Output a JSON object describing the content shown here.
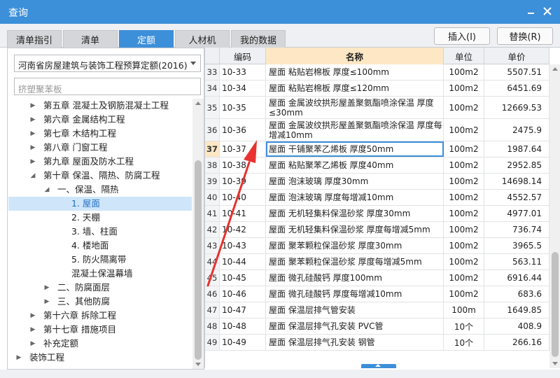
{
  "window": {
    "title": "查询"
  },
  "tabs": [
    {
      "label": "清单指引"
    },
    {
      "label": "清单"
    },
    {
      "label": "定额",
      "active": true
    },
    {
      "label": "人材机"
    },
    {
      "label": "我的数据"
    }
  ],
  "actions": {
    "insert_label": "插入(I)",
    "replace_label": "替换(R)"
  },
  "left_panel": {
    "library_selected": "河南省房屋建筑与装饰工程预算定额(2016)",
    "search_placeholder": "挤塑聚苯板",
    "tree": [
      {
        "label": "第五章 混凝土及钢筋混凝土工程",
        "toggle": "▶"
      },
      {
        "label": "第六章 金属结构工程",
        "toggle": "▶"
      },
      {
        "label": "第七章 木结构工程",
        "toggle": "▶"
      },
      {
        "label": "第八章 门窗工程",
        "toggle": "▶"
      },
      {
        "label": "第九章 屋面及防水工程",
        "toggle": "▶"
      },
      {
        "label": "第十章 保温、隔热、防腐工程",
        "toggle": "◢"
      },
      {
        "label": "一、保温、隔热",
        "toggle": "◢"
      },
      {
        "label": "1. 屋面",
        "toggle": "",
        "selected": true
      },
      {
        "label": "2. 天棚",
        "toggle": ""
      },
      {
        "label": "3. 墙、柱面",
        "toggle": ""
      },
      {
        "label": "4. 楼地面",
        "toggle": ""
      },
      {
        "label": "5. 防火隔离带",
        "toggle": ""
      },
      {
        "label": "混凝土保温幕墙",
        "toggle": ""
      },
      {
        "label": "二、防腐面层",
        "toggle": "▶"
      },
      {
        "label": "三、其他防腐",
        "toggle": "▶"
      },
      {
        "label": "第十六章 拆除工程",
        "toggle": "▶"
      },
      {
        "label": "第十七章 措施项目",
        "toggle": "▶"
      },
      {
        "label": "补充定额",
        "toggle": "▶"
      },
      {
        "label": "装饰工程",
        "toggle": "▶"
      }
    ]
  },
  "table": {
    "headers": {
      "code": "编码",
      "name": "名称",
      "unit": "单位",
      "price": "单价"
    },
    "current_row_index": 4,
    "rows": [
      {
        "idx": "33",
        "code": "10-33",
        "name": "屋面 粘贴岩棉板 厚度≤100mm",
        "unit": "100m2",
        "price": "5507.51"
      },
      {
        "idx": "34",
        "code": "10-34",
        "name": "屋面 粘贴岩棉板 厚度≤120mm",
        "unit": "100m2",
        "price": "6451.69"
      },
      {
        "idx": "35",
        "code": "10-35",
        "name": "屋面 金属波纹拱形屋盖聚氨酯喷涂保温 厚度≤30mm",
        "unit": "100m2",
        "price": "12669.53"
      },
      {
        "idx": "36",
        "code": "10-36",
        "name": "屋面 金属波纹拱形屋盖聚氨酯喷涂保温 厚度每增减10mm",
        "unit": "100m2",
        "price": "2475.9"
      },
      {
        "idx": "37",
        "code": "10-37",
        "name": "屋面 干铺聚苯乙烯板 厚度50mm",
        "unit": "100m2",
        "price": "1987.64"
      },
      {
        "idx": "38",
        "code": "10-38",
        "name": "屋面 粘贴聚苯乙烯板 厚度40mm",
        "unit": "100m2",
        "price": "2952.85"
      },
      {
        "idx": "39",
        "code": "10-39",
        "name": "屋面 泡沫玻璃 厚度30mm",
        "unit": "100m2",
        "price": "14698.14"
      },
      {
        "idx": "40",
        "code": "10-40",
        "name": "屋面 泡沫玻璃 厚度每增减10mm",
        "unit": "100m2",
        "price": "4552.57"
      },
      {
        "idx": "41",
        "code": "10-41",
        "name": "屋面 无机轻集料保温砂浆 厚度30mm",
        "unit": "100m2",
        "price": "4977.01"
      },
      {
        "idx": "42",
        "code": "10-42",
        "name": "屋面 无机轻集料保温砂浆 厚度每增减5mm",
        "unit": "100m2",
        "price": "736.74"
      },
      {
        "idx": "43",
        "code": "10-43",
        "name": "屋面 聚苯颗粒保温砂浆 厚度30mm",
        "unit": "100m2",
        "price": "3965.5"
      },
      {
        "idx": "44",
        "code": "10-44",
        "name": "屋面 聚苯颗粒保温砂浆 厚度每增减5mm",
        "unit": "100m2",
        "price": "563.11"
      },
      {
        "idx": "45",
        "code": "10-45",
        "name": "屋面 微孔硅酸钙 厚度100mm",
        "unit": "100m2",
        "price": "6916.44"
      },
      {
        "idx": "46",
        "code": "10-46",
        "name": "屋面 微孔硅酸钙 厚度每增减10mm",
        "unit": "100m2",
        "price": "683.6"
      },
      {
        "idx": "47",
        "code": "10-47",
        "name": "屋面 保温层排气管安装",
        "unit": "100m",
        "price": "1649.85"
      },
      {
        "idx": "48",
        "code": "10-48",
        "name": "屋面 保温层排气孔安装 PVC管",
        "unit": "10个",
        "price": "408.9"
      },
      {
        "idx": "49",
        "code": "10-49",
        "name": "屋面 保温层排气孔安装 钢管",
        "unit": "10个",
        "price": "266.16"
      }
    ]
  },
  "colors": {
    "accent": "#3c8fd9",
    "annotation_arrow": "#e8322f",
    "header_highlight": "#fde7c4"
  }
}
